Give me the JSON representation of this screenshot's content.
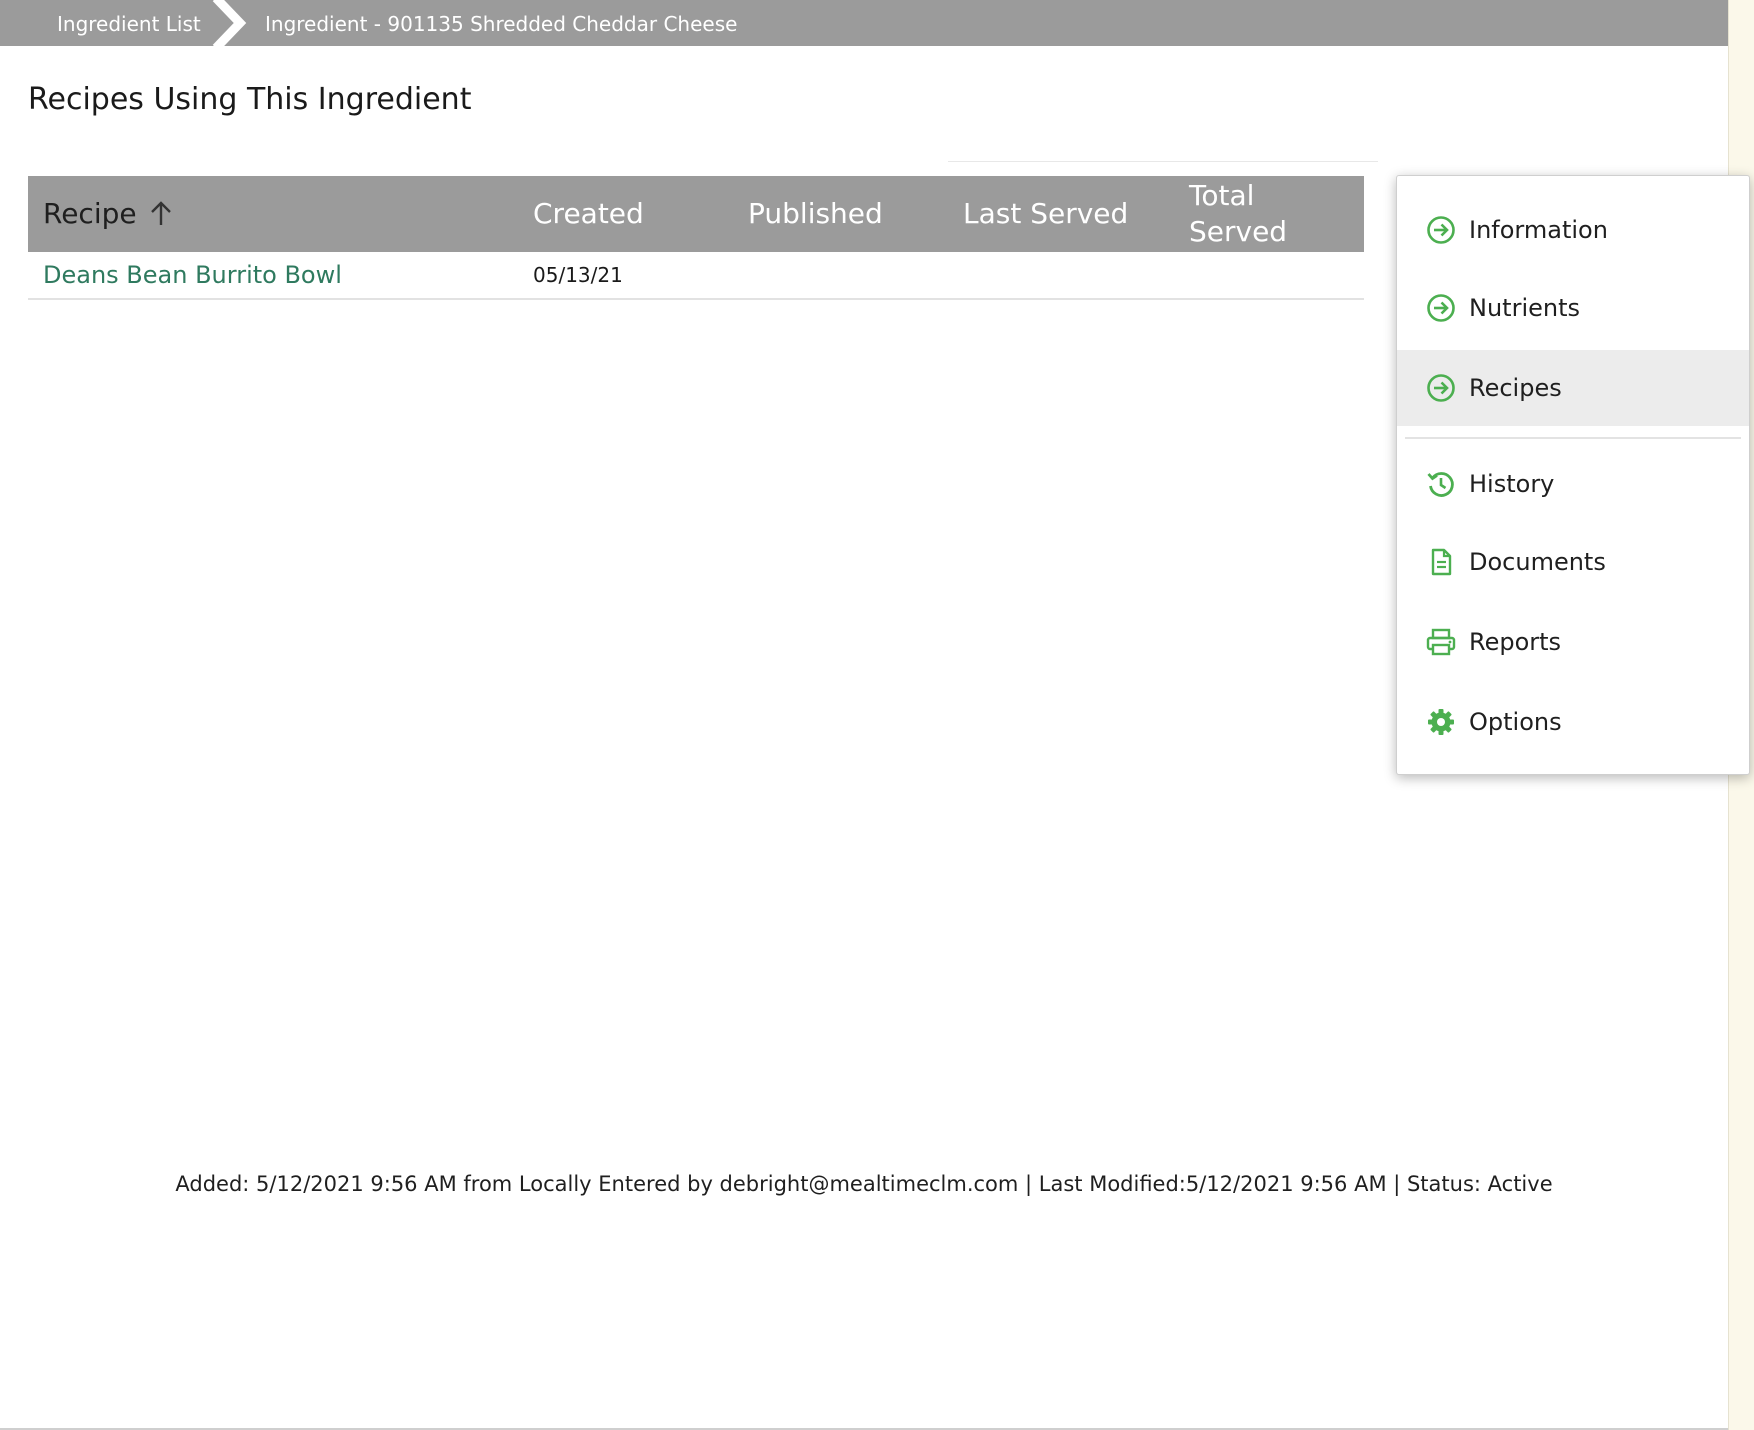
{
  "breadcrumb": {
    "items": [
      "Ingredient List",
      "Ingredient - 901135 Shredded Cheddar Cheese"
    ]
  },
  "page": {
    "title": "Recipes Using This Ingredient"
  },
  "table": {
    "columns": [
      "Recipe",
      "Created",
      "Published",
      "Last Served",
      "Total Served"
    ],
    "sort": {
      "column": "Recipe",
      "direction": "ascending"
    },
    "rows": [
      {
        "recipe": "Deans Bean Burrito Bowl",
        "created": "05/13/21",
        "published": "",
        "last_served": "",
        "total_served": ""
      }
    ]
  },
  "side_menu": {
    "items": [
      {
        "label": "Information",
        "icon": "arrow-circle-right-icon",
        "active": false
      },
      {
        "label": "Nutrients",
        "icon": "arrow-circle-right-icon",
        "active": false
      },
      {
        "label": "Recipes",
        "icon": "arrow-circle-right-icon",
        "active": true
      },
      {
        "label": "History",
        "icon": "history-icon",
        "active": false
      },
      {
        "label": "Documents",
        "icon": "document-icon",
        "active": false
      },
      {
        "label": "Reports",
        "icon": "printer-icon",
        "active": false
      },
      {
        "label": "Options",
        "icon": "gear-icon",
        "active": false
      }
    ]
  },
  "footer": {
    "meta": "Added: 5/12/2021 9:56 AM from Locally Entered by debright@mealtimeclm.com | Last Modified:5/12/2021 9:56 AM | Status: Active"
  },
  "colors": {
    "header_gray": "#9b9b9b",
    "link_green": "#2f7a5f",
    "icon_green": "#4caf50",
    "active_row": "#ececec"
  }
}
